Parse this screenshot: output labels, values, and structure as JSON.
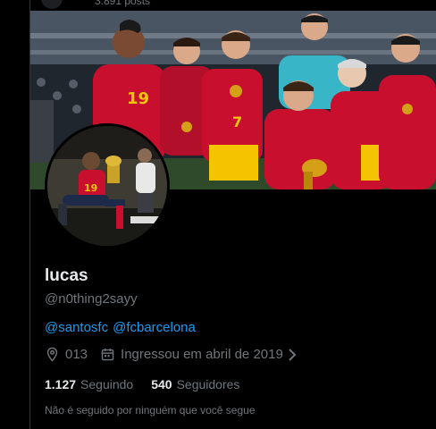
{
  "header": {
    "post_count": "3.891 posts"
  },
  "profile": {
    "display_name": "lucas",
    "handle": "@n0thing2sayy",
    "bio_links": [
      "@santosfc",
      "@fcbarcelona"
    ],
    "location": "013",
    "joined": "Ingressou em abril de 2019",
    "following_count": "1.127",
    "following_label": "Seguindo",
    "followers_count": "540",
    "followers_label": "Seguidores",
    "followed_by_note": "Não é seguido por ninguém que você segue"
  },
  "icons": {
    "location": "location-pin-icon",
    "calendar": "calendar-icon",
    "chevron": "chevron-right-icon"
  },
  "colors": {
    "background": "#000000",
    "link": "#1d9bf0",
    "secondary_text": "#71767b",
    "primary_text": "#e7e9ea",
    "jersey_red": "#c8102e"
  }
}
